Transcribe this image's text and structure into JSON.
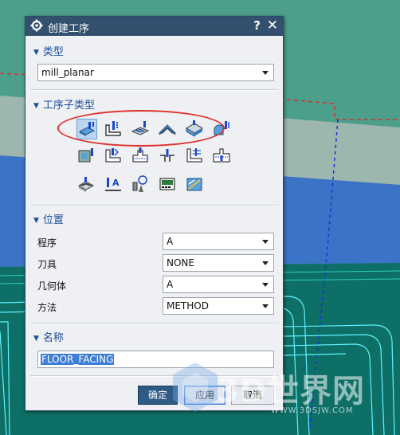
{
  "dialog": {
    "title": "创建工序",
    "help": "?",
    "close": "✕"
  },
  "type_section": {
    "header": "类型",
    "value": "mill_planar"
  },
  "subtype_section": {
    "header": "工序子类型",
    "icons": [
      {
        "name": "floor-wall-op-icon",
        "selected": true
      },
      {
        "name": "floor-wall-ipw-op-icon",
        "selected": false
      },
      {
        "name": "face-milling-op-icon",
        "selected": false
      },
      {
        "name": "face-milling-manual-op-icon",
        "selected": false
      },
      {
        "name": "face-milling-area-op-icon",
        "selected": false
      },
      {
        "name": "planar-mill-op-icon",
        "selected": false
      },
      {
        "name": "planar-profile-op-icon",
        "selected": false
      },
      {
        "name": "cleanup-corners-op-icon",
        "selected": false
      },
      {
        "name": "finish-walls-op-icon",
        "selected": false
      },
      {
        "name": "finish-floor-op-icon",
        "selected": false
      },
      {
        "name": "groove-milling-op-icon",
        "selected": false
      },
      {
        "name": "hole-milling-op-icon",
        "selected": false
      },
      {
        "name": "thread-milling-op-icon",
        "selected": false
      },
      {
        "name": "planar-text-op-icon",
        "selected": false
      },
      {
        "name": "mill-control-op-icon",
        "selected": false
      },
      {
        "name": "mill-user-op-icon",
        "selected": false
      },
      {
        "name": "planar-chamfer-op-icon",
        "selected": false
      }
    ]
  },
  "position_section": {
    "header": "位置",
    "rows": [
      {
        "label": "程序",
        "value": "A"
      },
      {
        "label": "刀具",
        "value": "NONE"
      },
      {
        "label": "几何体",
        "value": "A"
      },
      {
        "label": "方法",
        "value": "METHOD"
      }
    ]
  },
  "name_section": {
    "header": "名称",
    "value": "FLOOR_FACING"
  },
  "buttons": {
    "ok": "确定",
    "apply": "应用",
    "cancel": "取消"
  },
  "watermark": {
    "logo_text": "3D世界网",
    "url": "WWW.3DSJW.COM"
  },
  "colors": {
    "titlebar": "#33506f",
    "section_header": "#1c4d9a",
    "ok_button": "#2e5a86",
    "selection": "#3d7fd6",
    "annotation": "#e0302a"
  }
}
